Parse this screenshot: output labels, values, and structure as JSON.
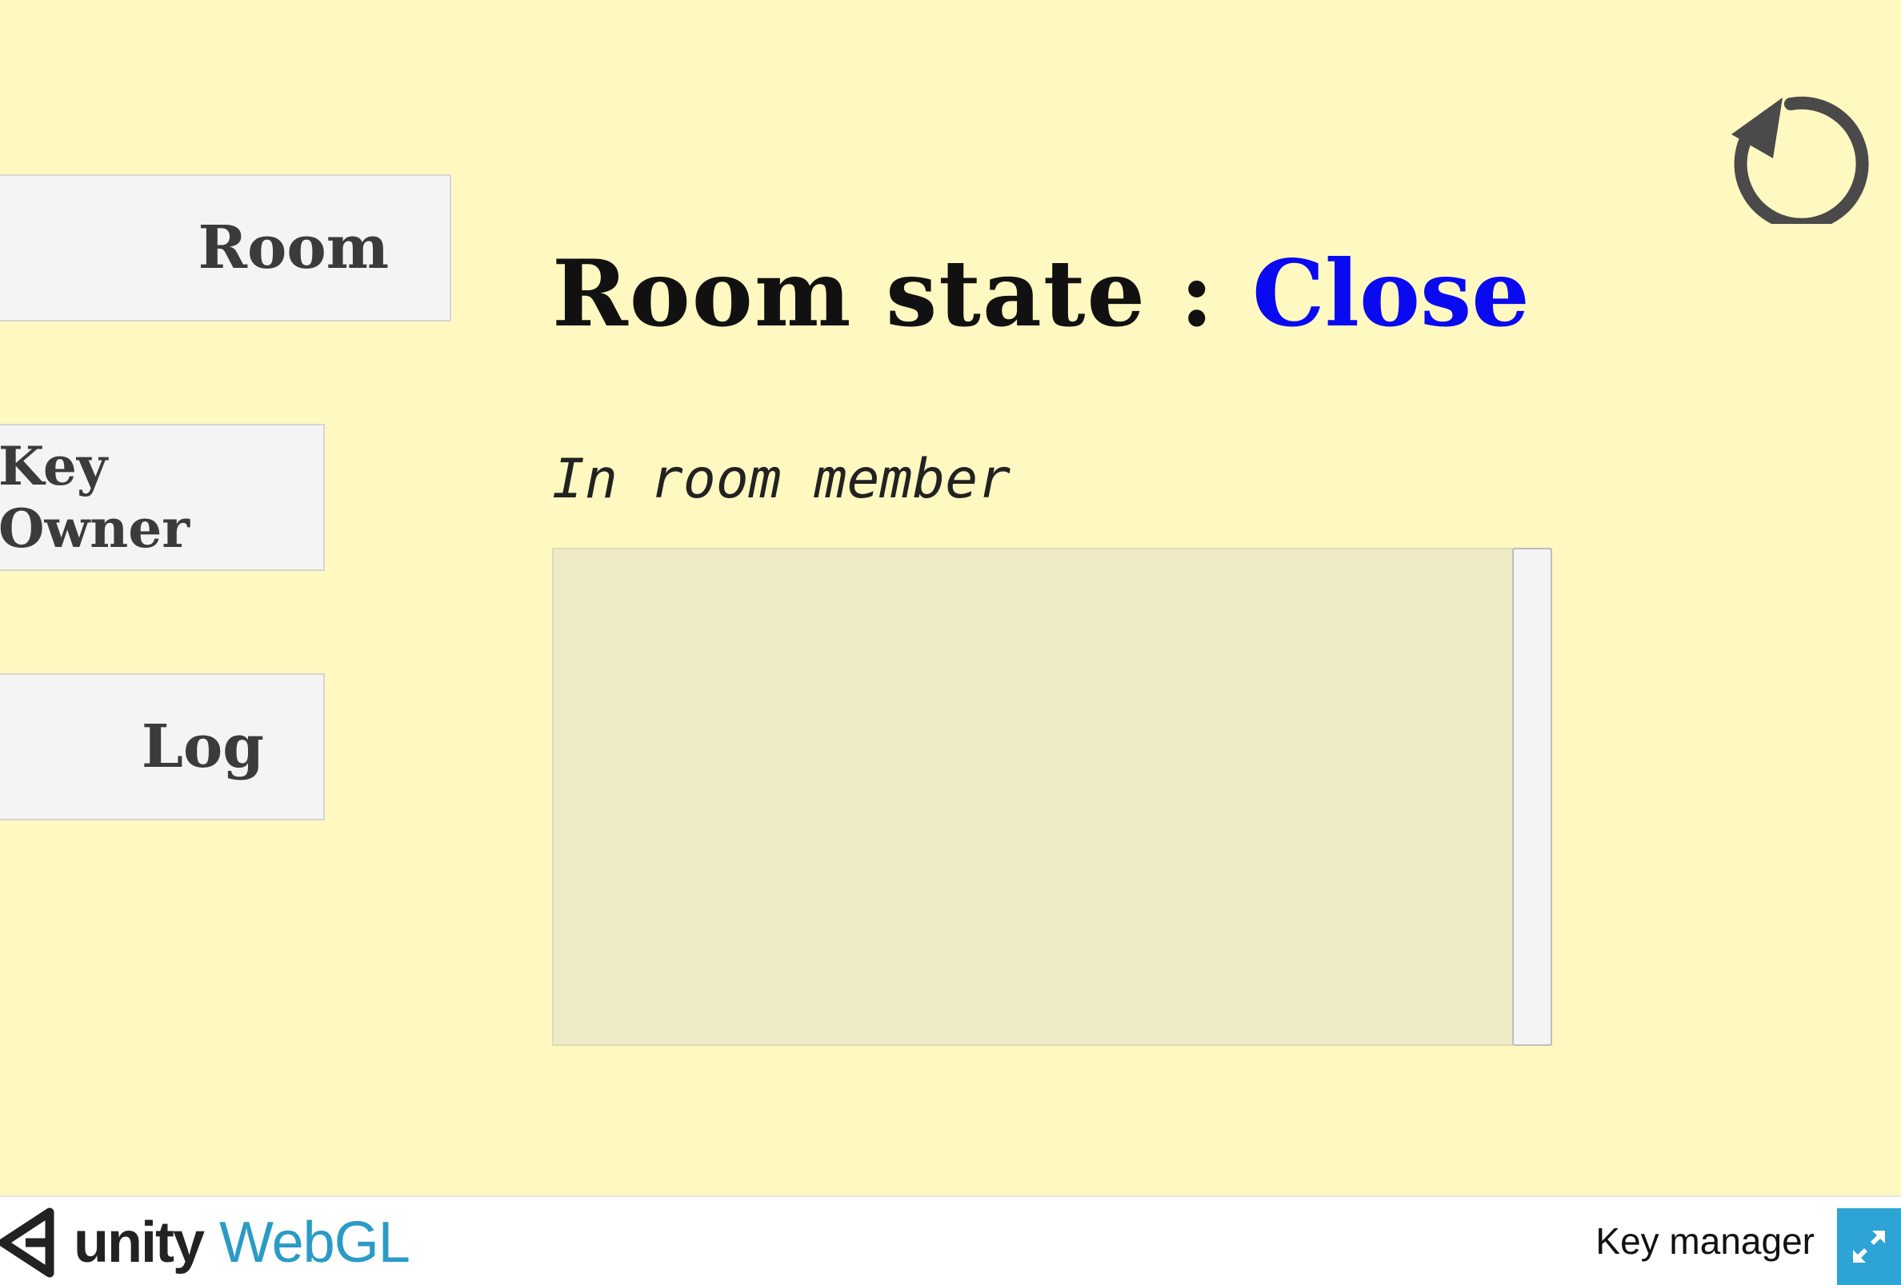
{
  "nav": {
    "room": "Room",
    "key_owner": "Key Owner",
    "log": "Log"
  },
  "room_state": {
    "label": "Room state :",
    "value": "Close",
    "value_color": "#0a0af0"
  },
  "members": {
    "label": "In room member",
    "items": []
  },
  "icons": {
    "reset": "refresh-icon",
    "fullscreen": "fullscreen-icon",
    "logo": "unity-logo-icon"
  },
  "footer": {
    "logo_unity": "unity",
    "logo_webgl": "WebGL",
    "title": "Key manager"
  },
  "colors": {
    "canvas_bg": "#fff8c0",
    "webgl_blue": "#2a9bc6",
    "fullscreen_bg": "#2ea3d5"
  }
}
